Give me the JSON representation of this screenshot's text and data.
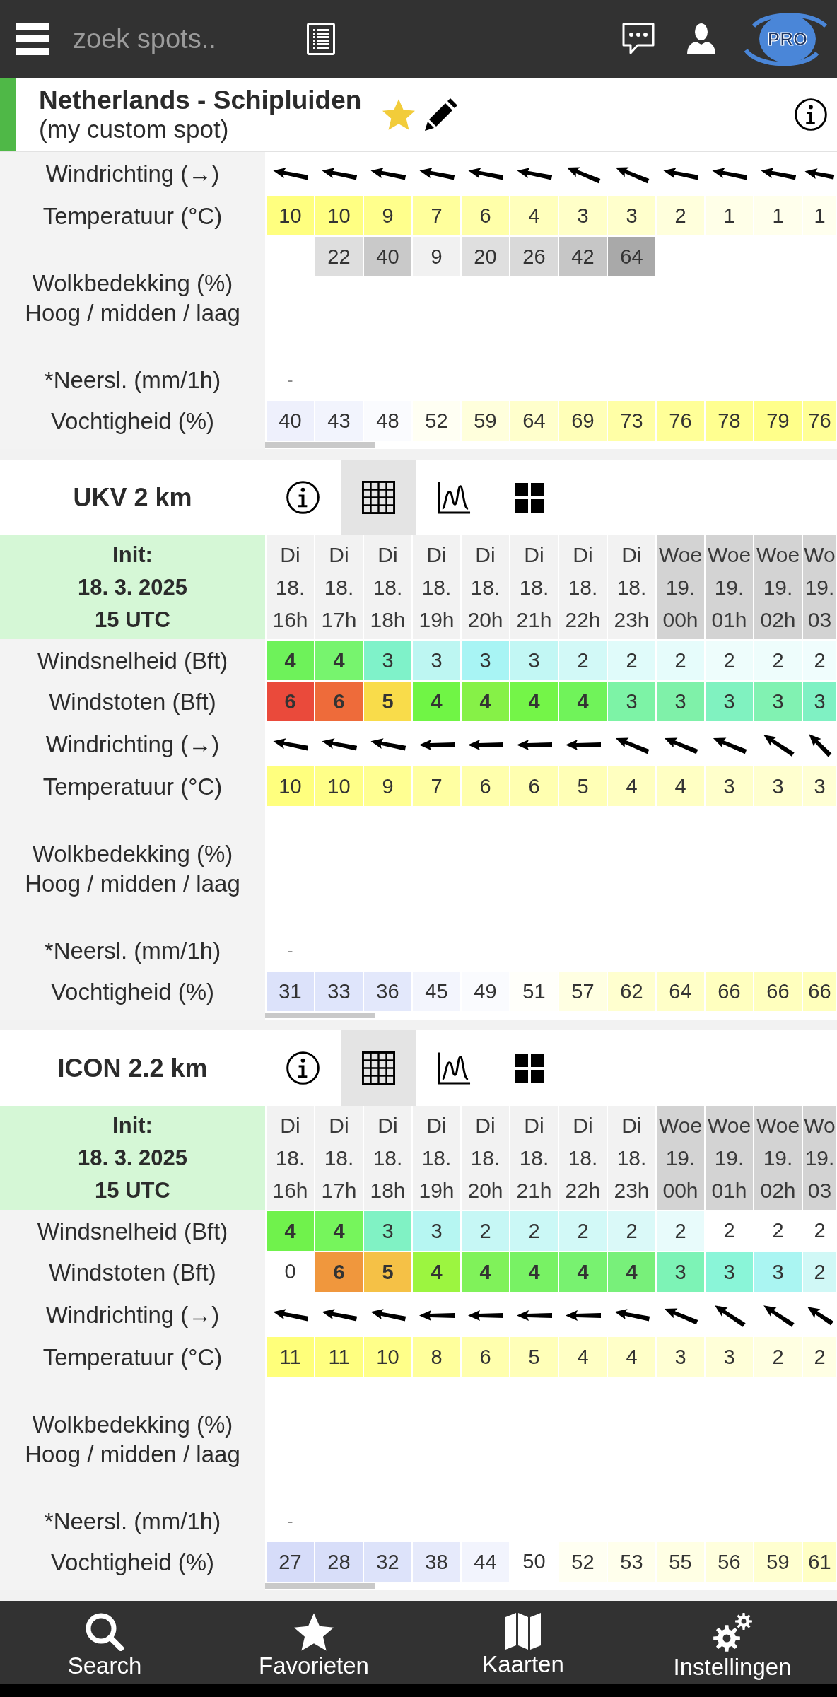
{
  "top_bar": {
    "search": {
      "placeholder": "zoek spots.."
    },
    "logo": {
      "text": "PRO"
    }
  },
  "spot": {
    "title": "Netherlands - Schipluiden",
    "subtitle": "(my custom spot)",
    "favorite": true
  },
  "sections": [
    {
      "rows": [
        {
          "kind": "arrows",
          "label": "Windrichting (→)",
          "cells": [
            {
              "kind": "wbn"
            },
            {
              "kind": "wbn"
            },
            {
              "kind": "wbn"
            },
            {
              "kind": "wbn"
            },
            {
              "kind": "wbn"
            },
            {
              "kind": "wbn"
            },
            {
              "kind": "wnw"
            },
            {
              "kind": "wnw"
            },
            {
              "kind": "wbn"
            },
            {
              "kind": "wbn"
            },
            {
              "kind": "wbn"
            },
            {
              "kind": "wbn"
            }
          ]
        },
        {
          "kind": "numbers",
          "label": "Temperatuur (°C)",
          "cells": [
            {
              "text": "10",
              "color": "#ffff7f"
            },
            {
              "text": "10",
              "color": "#ffff82"
            },
            {
              "text": "9",
              "color": "#ffff8c"
            },
            {
              "text": "7",
              "color": "#ffff9c"
            },
            {
              "text": "6",
              "color": "#ffffa9"
            },
            {
              "text": "4",
              "color": "#ffffbc"
            },
            {
              "text": "3",
              "color": "#ffffc8"
            },
            {
              "text": "3",
              "color": "#ffffcc"
            },
            {
              "text": "2",
              "color": "#ffffdc"
            },
            {
              "text": "1",
              "color": "#ffffe8"
            },
            {
              "text": "1",
              "color": "#ffffec"
            },
            {
              "text": "1",
              "color": "#ffffee"
            }
          ]
        },
        {
          "kind": "clouds",
          "label": "Wolkbedekking (%)",
          "sublabel": "Hoog / midden / laag",
          "high": [
            {
              "kind": "blank"
            },
            {
              "kind": "value",
              "text": "22",
              "color": "#dedede"
            },
            {
              "kind": "value",
              "text": "40",
              "color": "#c9c9c9"
            },
            {
              "kind": "value",
              "text": "9",
              "color": "#f1f1f1"
            },
            {
              "kind": "value",
              "text": "20",
              "color": "#dfdfdf"
            },
            {
              "kind": "value",
              "text": "26",
              "color": "#d9d9d9"
            },
            {
              "kind": "value",
              "text": "42",
              "color": "#c6c6c6"
            },
            {
              "kind": "value",
              "text": "64",
              "color": "#a9a9a9"
            }
          ]
        },
        {
          "kind": "precip",
          "label": "*Neersl. (mm/1h)",
          "cells": [
            {
              "text": "-"
            }
          ]
        },
        {
          "kind": "numbers",
          "label": "Vochtigheid (%)",
          "cells": [
            {
              "text": "40",
              "color": "#eef0fc"
            },
            {
              "text": "43",
              "color": "#f2f4fd"
            },
            {
              "text": "48",
              "color": "#fafbfe"
            },
            {
              "text": "52",
              "color": "#fffff3"
            },
            {
              "text": "59",
              "color": "#ffffdc"
            },
            {
              "text": "64",
              "color": "#ffffcc"
            },
            {
              "text": "69",
              "color": "#ffffb8"
            },
            {
              "text": "73",
              "color": "#ffffa6"
            },
            {
              "text": "76",
              "color": "#ffff98"
            },
            {
              "text": "78",
              "color": "#ffff90"
            },
            {
              "text": "79",
              "color": "#ffff8a"
            },
            {
              "text": "76",
              "color": "#ffff96"
            }
          ]
        }
      ]
    },
    {
      "model": "UKV 2 km",
      "tabs": [
        {
          "kind": "info",
          "selected": false
        },
        {
          "kind": "table",
          "selected": true
        },
        {
          "kind": "graph",
          "selected": false
        },
        {
          "kind": "tiles",
          "selected": false
        }
      ],
      "init": {
        "label": "Init:",
        "date": "18. 3. 2025",
        "time": "15 UTC"
      },
      "columns": [
        {
          "day": "Di",
          "date": "18.",
          "hour": "16h",
          "shaded": false
        },
        {
          "day": "Di",
          "date": "18.",
          "hour": "17h",
          "shaded": false
        },
        {
          "day": "Di",
          "date": "18.",
          "hour": "18h",
          "shaded": false
        },
        {
          "day": "Di",
          "date": "18.",
          "hour": "19h",
          "shaded": false
        },
        {
          "day": "Di",
          "date": "18.",
          "hour": "20h",
          "shaded": false
        },
        {
          "day": "Di",
          "date": "18.",
          "hour": "21h",
          "shaded": false
        },
        {
          "day": "Di",
          "date": "18.",
          "hour": "22h",
          "shaded": false
        },
        {
          "day": "Di",
          "date": "18.",
          "hour": "23h",
          "shaded": false
        },
        {
          "day": "Woe",
          "date": "19.",
          "hour": "00h",
          "shaded": true
        },
        {
          "day": "Woe",
          "date": "19.",
          "hour": "01h",
          "shaded": true
        },
        {
          "day": "Woe",
          "date": "19.",
          "hour": "02h",
          "shaded": true
        },
        {
          "day": "Wo",
          "date": "19.",
          "hour": "03",
          "shaded": true
        }
      ],
      "rows": [
        {
          "kind": "wind",
          "label": "Windsnelheid (Bft)",
          "cells": [
            {
              "text": "4",
              "color": "#6ef25a",
              "bold": true
            },
            {
              "text": "4",
              "color": "#77f46e",
              "bold": true
            },
            {
              "text": "3",
              "color": "#7ff2c9",
              "bold": false
            },
            {
              "text": "3",
              "color": "#bdf6f2",
              "bold": false
            },
            {
              "text": "3",
              "color": "#a8f4f4",
              "bold": false
            },
            {
              "text": "3",
              "color": "#c2f7f4",
              "bold": false
            },
            {
              "text": "2",
              "color": "#d2f9f7",
              "bold": false
            },
            {
              "text": "2",
              "color": "#e0fbfa",
              "bold": false
            },
            {
              "text": "2",
              "color": "#e6fcfb",
              "bold": false
            },
            {
              "text": "2",
              "color": "#eefdfc",
              "bold": false
            },
            {
              "text": "2",
              "color": "#eefdfc",
              "bold": false
            },
            {
              "text": "2",
              "color": "#f0fdfd",
              "bold": false
            }
          ]
        },
        {
          "kind": "wind",
          "label": "Windstoten (Bft)",
          "cells": [
            {
              "text": "6",
              "color": "#ea4a3b",
              "bold": true
            },
            {
              "text": "6",
              "color": "#ee6b3a",
              "bold": true
            },
            {
              "text": "5",
              "color": "#f9dc4a",
              "bold": true
            },
            {
              "text": "4",
              "color": "#70f545",
              "bold": true
            },
            {
              "text": "4",
              "color": "#86f147",
              "bold": true
            },
            {
              "text": "4",
              "color": "#74f548",
              "bold": true
            },
            {
              "text": "4",
              "color": "#70f35a",
              "bold": true
            },
            {
              "text": "3",
              "color": "#7df3a6",
              "bold": false
            },
            {
              "text": "3",
              "color": "#7ff1a9",
              "bold": false
            },
            {
              "text": "3",
              "color": "#80f2c0",
              "bold": false
            },
            {
              "text": "3",
              "color": "#81f2b2",
              "bold": false
            },
            {
              "text": "3",
              "color": "#7ff1c3",
              "bold": false
            }
          ]
        },
        {
          "kind": "arrows",
          "label": "Windrichting (→)",
          "cells": [
            {
              "kind": "wbn"
            },
            {
              "kind": "wbn"
            },
            {
              "kind": "wbn"
            },
            {
              "kind": "w"
            },
            {
              "kind": "w"
            },
            {
              "kind": "w"
            },
            {
              "kind": "w"
            },
            {
              "kind": "wnw"
            },
            {
              "kind": "wnw"
            },
            {
              "kind": "wnw"
            },
            {
              "kind": "nwbw"
            },
            {
              "kind": "nw"
            }
          ]
        },
        {
          "kind": "numbers",
          "label": "Temperatuur (°C)",
          "cells": [
            {
              "text": "10",
              "color": "#ffff7e"
            },
            {
              "text": "10",
              "color": "#ffff88"
            },
            {
              "text": "9",
              "color": "#ffff92"
            },
            {
              "text": "7",
              "color": "#ffffa2"
            },
            {
              "text": "6",
              "color": "#ffffac"
            },
            {
              "text": "6",
              "color": "#ffffb0"
            },
            {
              "text": "5",
              "color": "#ffffb6"
            },
            {
              "text": "4",
              "color": "#ffffc0"
            },
            {
              "text": "4",
              "color": "#ffffc3"
            },
            {
              "text": "3",
              "color": "#ffffcb"
            },
            {
              "text": "3",
              "color": "#ffffcf"
            },
            {
              "text": "3",
              "color": "#ffffd4"
            }
          ]
        },
        {
          "kind": "clouds",
          "label": "Wolkbedekking (%)",
          "sublabel": "Hoog / midden / laag"
        },
        {
          "kind": "precip",
          "label": "*Neersl. (mm/1h)",
          "cells": [
            {
              "text": "-"
            }
          ]
        },
        {
          "kind": "numbers",
          "label": "Vochtigheid (%)",
          "cells": [
            {
              "text": "31",
              "color": "#dce2fa"
            },
            {
              "text": "33",
              "color": "#dfe5fb"
            },
            {
              "text": "36",
              "color": "#e3e8fb"
            },
            {
              "text": "45",
              "color": "#f3f5fd"
            },
            {
              "text": "49",
              "color": "#fafbfe"
            },
            {
              "text": "51",
              "color": "#fffffa"
            },
            {
              "text": "57",
              "color": "#ffffe2"
            },
            {
              "text": "62",
              "color": "#ffffcf"
            },
            {
              "text": "64",
              "color": "#ffffc8"
            },
            {
              "text": "66",
              "color": "#ffffbf"
            },
            {
              "text": "66",
              "color": "#ffffbe"
            },
            {
              "text": "66",
              "color": "#ffffbc"
            }
          ]
        }
      ]
    },
    {
      "model": "ICON 2.2 km",
      "tabs": [
        {
          "kind": "info",
          "selected": false
        },
        {
          "kind": "table",
          "selected": true
        },
        {
          "kind": "graph",
          "selected": false
        },
        {
          "kind": "tiles",
          "selected": false
        }
      ],
      "init": {
        "label": "Init:",
        "date": "18. 3. 2025",
        "time": "15 UTC"
      },
      "columns": [
        {
          "day": "Di",
          "date": "18.",
          "hour": "16h",
          "shaded": false
        },
        {
          "day": "Di",
          "date": "18.",
          "hour": "17h",
          "shaded": false
        },
        {
          "day": "Di",
          "date": "18.",
          "hour": "18h",
          "shaded": false
        },
        {
          "day": "Di",
          "date": "18.",
          "hour": "19h",
          "shaded": false
        },
        {
          "day": "Di",
          "date": "18.",
          "hour": "20h",
          "shaded": false
        },
        {
          "day": "Di",
          "date": "18.",
          "hour": "21h",
          "shaded": false
        },
        {
          "day": "Di",
          "date": "18.",
          "hour": "22h",
          "shaded": false
        },
        {
          "day": "Di",
          "date": "18.",
          "hour": "23h",
          "shaded": false
        },
        {
          "day": "Woe",
          "date": "19.",
          "hour": "00h",
          "shaded": true
        },
        {
          "day": "Woe",
          "date": "19.",
          "hour": "01h",
          "shaded": true
        },
        {
          "day": "Woe",
          "date": "19.",
          "hour": "02h",
          "shaded": true
        },
        {
          "day": "Wo",
          "date": "19.",
          "hour": "03",
          "shaded": true
        }
      ],
      "rows": [
        {
          "kind": "wind",
          "label": "Windsnelheid (Bft)",
          "cells": [
            {
              "text": "4",
              "color": "#70f24c",
              "bold": true
            },
            {
              "text": "4",
              "color": "#76f55c",
              "bold": true
            },
            {
              "text": "3",
              "color": "#80f2c4",
              "bold": false
            },
            {
              "text": "3",
              "color": "#b6f6f2",
              "bold": false
            },
            {
              "text": "2",
              "color": "#c6f7f5",
              "bold": false
            },
            {
              "text": "2",
              "color": "#cbf8f6",
              "bold": false
            },
            {
              "text": "2",
              "color": "#d2f9f7",
              "bold": false
            },
            {
              "text": "2",
              "color": "#daf9f8",
              "bold": false
            },
            {
              "text": "2",
              "color": "#e8fbfb",
              "bold": false
            },
            {
              "text": "2",
              "bold": false
            },
            {
              "text": "2",
              "bold": false
            },
            {
              "text": "2",
              "bold": false
            }
          ]
        },
        {
          "kind": "wind",
          "label": "Windstoten (Bft)",
          "cells": [
            {
              "text": "0",
              "bold": false
            },
            {
              "text": "6",
              "color": "#f0973d",
              "bold": true
            },
            {
              "text": "5",
              "color": "#f5c146",
              "bold": true
            },
            {
              "text": "4",
              "color": "#9cf540",
              "bold": true
            },
            {
              "text": "4",
              "color": "#80f25a",
              "bold": true
            },
            {
              "text": "4",
              "color": "#78f264",
              "bold": true
            },
            {
              "text": "4",
              "color": "#78f270",
              "bold": true
            },
            {
              "text": "4",
              "color": "#78f07a",
              "bold": true
            },
            {
              "text": "3",
              "color": "#7df3b6",
              "bold": false
            },
            {
              "text": "3",
              "color": "#8af5d8",
              "bold": false
            },
            {
              "text": "3",
              "color": "#aaf5f2",
              "bold": false
            },
            {
              "text": "2",
              "color": "#d0f8f6",
              "bold": false
            }
          ]
        },
        {
          "kind": "arrows",
          "label": "Windrichting (→)",
          "cells": [
            {
              "kind": "wbn"
            },
            {
              "kind": "wbn"
            },
            {
              "kind": "wbn"
            },
            {
              "kind": "w"
            },
            {
              "kind": "w"
            },
            {
              "kind": "w"
            },
            {
              "kind": "w"
            },
            {
              "kind": "wbn"
            },
            {
              "kind": "wnw"
            },
            {
              "kind": "nwbw"
            },
            {
              "kind": "nwbw"
            },
            {
              "kind": "nwbw"
            }
          ]
        },
        {
          "kind": "numbers",
          "label": "Temperatuur (°C)",
          "cells": [
            {
              "text": "11",
              "color": "#ffff7a"
            },
            {
              "text": "11",
              "color": "#ffff80"
            },
            {
              "text": "10",
              "color": "#ffff89"
            },
            {
              "text": "8",
              "color": "#ffff9c"
            },
            {
              "text": "6",
              "color": "#ffffad"
            },
            {
              "text": "5",
              "color": "#ffffb8"
            },
            {
              "text": "4",
              "color": "#ffffc4"
            },
            {
              "text": "4",
              "color": "#ffffc8"
            },
            {
              "text": "3",
              "color": "#ffffd3"
            },
            {
              "text": "3",
              "color": "#ffffd8"
            },
            {
              "text": "2",
              "color": "#ffffe1"
            },
            {
              "text": "2",
              "color": "#ffffe4"
            }
          ]
        },
        {
          "kind": "clouds",
          "label": "Wolkbedekking (%)",
          "sublabel": "Hoog / midden / laag"
        },
        {
          "kind": "precip",
          "label": "*Neersl. (mm/1h)",
          "cells": [
            {
              "text": "-"
            }
          ]
        },
        {
          "kind": "numbers",
          "label": "Vochtigheid (%)",
          "cells": [
            {
              "text": "27",
              "color": "#d6dcf9"
            },
            {
              "text": "28",
              "color": "#d8def9"
            },
            {
              "text": "32",
              "color": "#dde3fa"
            },
            {
              "text": "38",
              "color": "#e6eafb"
            },
            {
              "text": "44",
              "color": "#f2f4fd"
            },
            {
              "text": "50"
            },
            {
              "text": "52",
              "color": "#fffff2"
            },
            {
              "text": "53",
              "color": "#ffffec"
            },
            {
              "text": "55",
              "color": "#ffffe4"
            },
            {
              "text": "56",
              "color": "#ffffdd"
            },
            {
              "text": "59",
              "color": "#ffffd0"
            },
            {
              "text": "61",
              "color": "#ffffc4"
            }
          ]
        }
      ]
    }
  ],
  "bottom_nav": [
    {
      "kind": "search",
      "label": "Search"
    },
    {
      "kind": "favorites",
      "label": "Favorieten"
    },
    {
      "kind": "maps",
      "label": "Kaarten"
    },
    {
      "kind": "settings",
      "label": "Instellingen"
    }
  ]
}
